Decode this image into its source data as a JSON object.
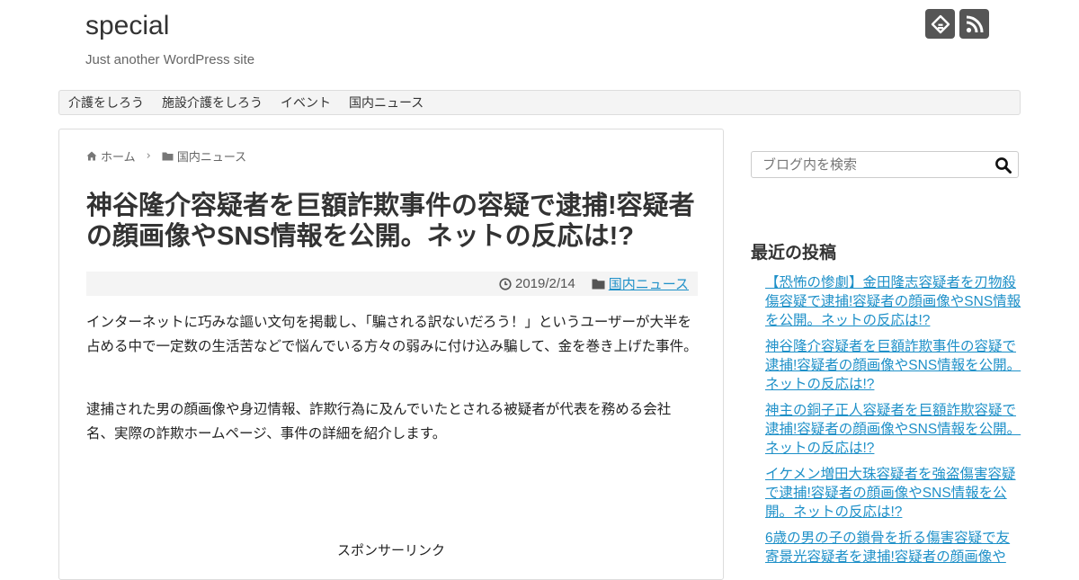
{
  "site": {
    "title": "special",
    "description": "Just another WordPress site"
  },
  "social": [
    {
      "icon": "feedly-icon"
    },
    {
      "icon": "rss-icon"
    }
  ],
  "nav": {
    "items": [
      "介護をしろう",
      "施設介護をしろう",
      "イベント",
      "国内ニュース"
    ]
  },
  "breadcrumb": {
    "home": "ホーム",
    "category": "国内ニュース"
  },
  "post": {
    "title": "神谷隆介容疑者を巨額詐欺事件の容疑で逮捕!容疑者の顔画像やSNS情報を公開。ネットの反応は!?",
    "date": "2019/2/14",
    "category": "国内ニュース",
    "paragraphs": [
      "インターネットに巧みな謳い文句を掲載し、「騙される訳ないだろう！」というユーザーが大半を占める中で一定数の生活苦などで悩んでいる方々の弱みに付け込み騙して、金を巻き上げた事件。",
      "逮捕された男の顔画像や身辺情報、詐欺行為に及んでいたとされる被疑者が代表を務める会社名、実際の詐欺ホームページ、事件の詳細を紹介します。"
    ],
    "sponsor_label": "スポンサーリンク"
  },
  "sidebar": {
    "search_placeholder": "ブログ内を検索",
    "recent_heading": "最近の投稿",
    "recent_posts": [
      "【恐怖の惨劇】金田隆志容疑者を刃物殺傷容疑で逮捕!容疑者の顔画像やSNS情報を公開。ネットの反応は!?",
      "神谷隆介容疑者を巨額詐欺事件の容疑で逮捕!容疑者の顔画像やSNS情報を公開。ネットの反応は!?",
      "神主の銅子正人容疑者を巨額詐欺容疑で逮捕!容疑者の顔画像やSNS情報を公開。ネットの反応は!?",
      "イケメン増田大珠容疑者を強盗傷害容疑で逮捕!容疑者の顔画像やSNS情報を公開。ネットの反応は!?",
      "6歳の男の子の鎖骨を折る傷害容疑で友寄景光容疑者を逮捕!容疑者の顔画像や"
    ]
  },
  "colors": {
    "link": "#1e90c8",
    "icon_bg": "#555555",
    "meta_bg": "#f4f4f4"
  }
}
